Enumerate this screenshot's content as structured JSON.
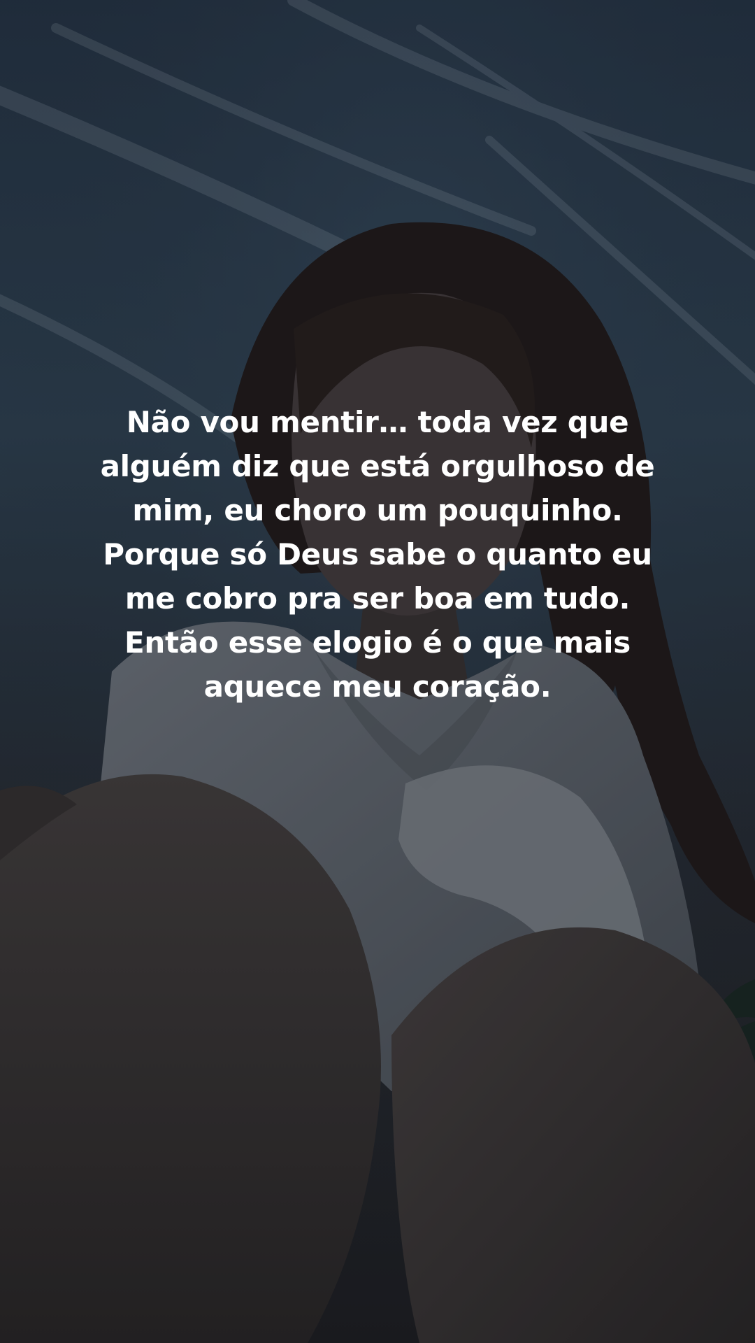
{
  "photo": {
    "subject_description_icon": "photo-background",
    "colors": {
      "sky_top": "#28384a",
      "sky_mid": "#34495a",
      "hair": "#2a1f1c",
      "shirt": "#6b7177",
      "skin_shadow": "#3a3432",
      "caption_text": "#ffffff"
    }
  },
  "caption": {
    "lines": [
      "Não vou mentir… toda vez que",
      "alguém diz que está orgulhoso de",
      "mim, eu choro um pouquinho.",
      "Porque só Deus sabe o quanto eu",
      "me cobro pra ser boa em tudo.",
      "Então esse elogio é o que mais",
      "aquece meu coração."
    ]
  }
}
